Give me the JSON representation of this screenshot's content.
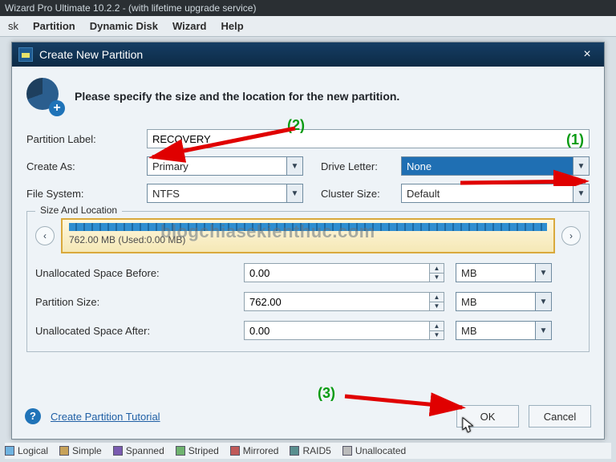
{
  "main_window": {
    "title": "Wizard Pro Ultimate 10.2.2 - (with lifetime upgrade service)"
  },
  "menu": {
    "items": [
      "sk",
      "Partition",
      "Dynamic Disk",
      "Wizard",
      "Help"
    ]
  },
  "dialog": {
    "title": "Create New Partition",
    "close_glyph": "×",
    "header": "Please specify the size and the location for the new partition.",
    "labels": {
      "partition_label": "Partition Label:",
      "create_as": "Create As:",
      "drive_letter": "Drive Letter:",
      "file_system": "File System:",
      "cluster_size": "Cluster Size:"
    },
    "values": {
      "partition_label": "RECOVERY",
      "create_as": "Primary",
      "drive_letter": "None",
      "file_system": "NTFS",
      "cluster_size": "Default"
    },
    "size_location": {
      "group_title": "Size And Location",
      "bar_text": "762.00 MB (Used:0.00 MB)",
      "rows": {
        "before_label": "Unallocated Space Before:",
        "before_value": "0.00",
        "size_label": "Partition Size:",
        "size_value": "762.00",
        "after_label": "Unallocated Space After:",
        "after_value": "0.00",
        "unit": "MB"
      }
    },
    "footer": {
      "tutorial": "Create Partition Tutorial",
      "ok": "OK",
      "cancel": "Cancel"
    }
  },
  "legend": {
    "items": [
      "Logical",
      "Simple",
      "Spanned",
      "Striped",
      "Mirrored",
      "RAID5",
      "Unallocated"
    ]
  },
  "annotations": {
    "a1": "(1)",
    "a2": "(2)",
    "a3": "(3)"
  },
  "watermark": "blogchiasekienthuc.com"
}
